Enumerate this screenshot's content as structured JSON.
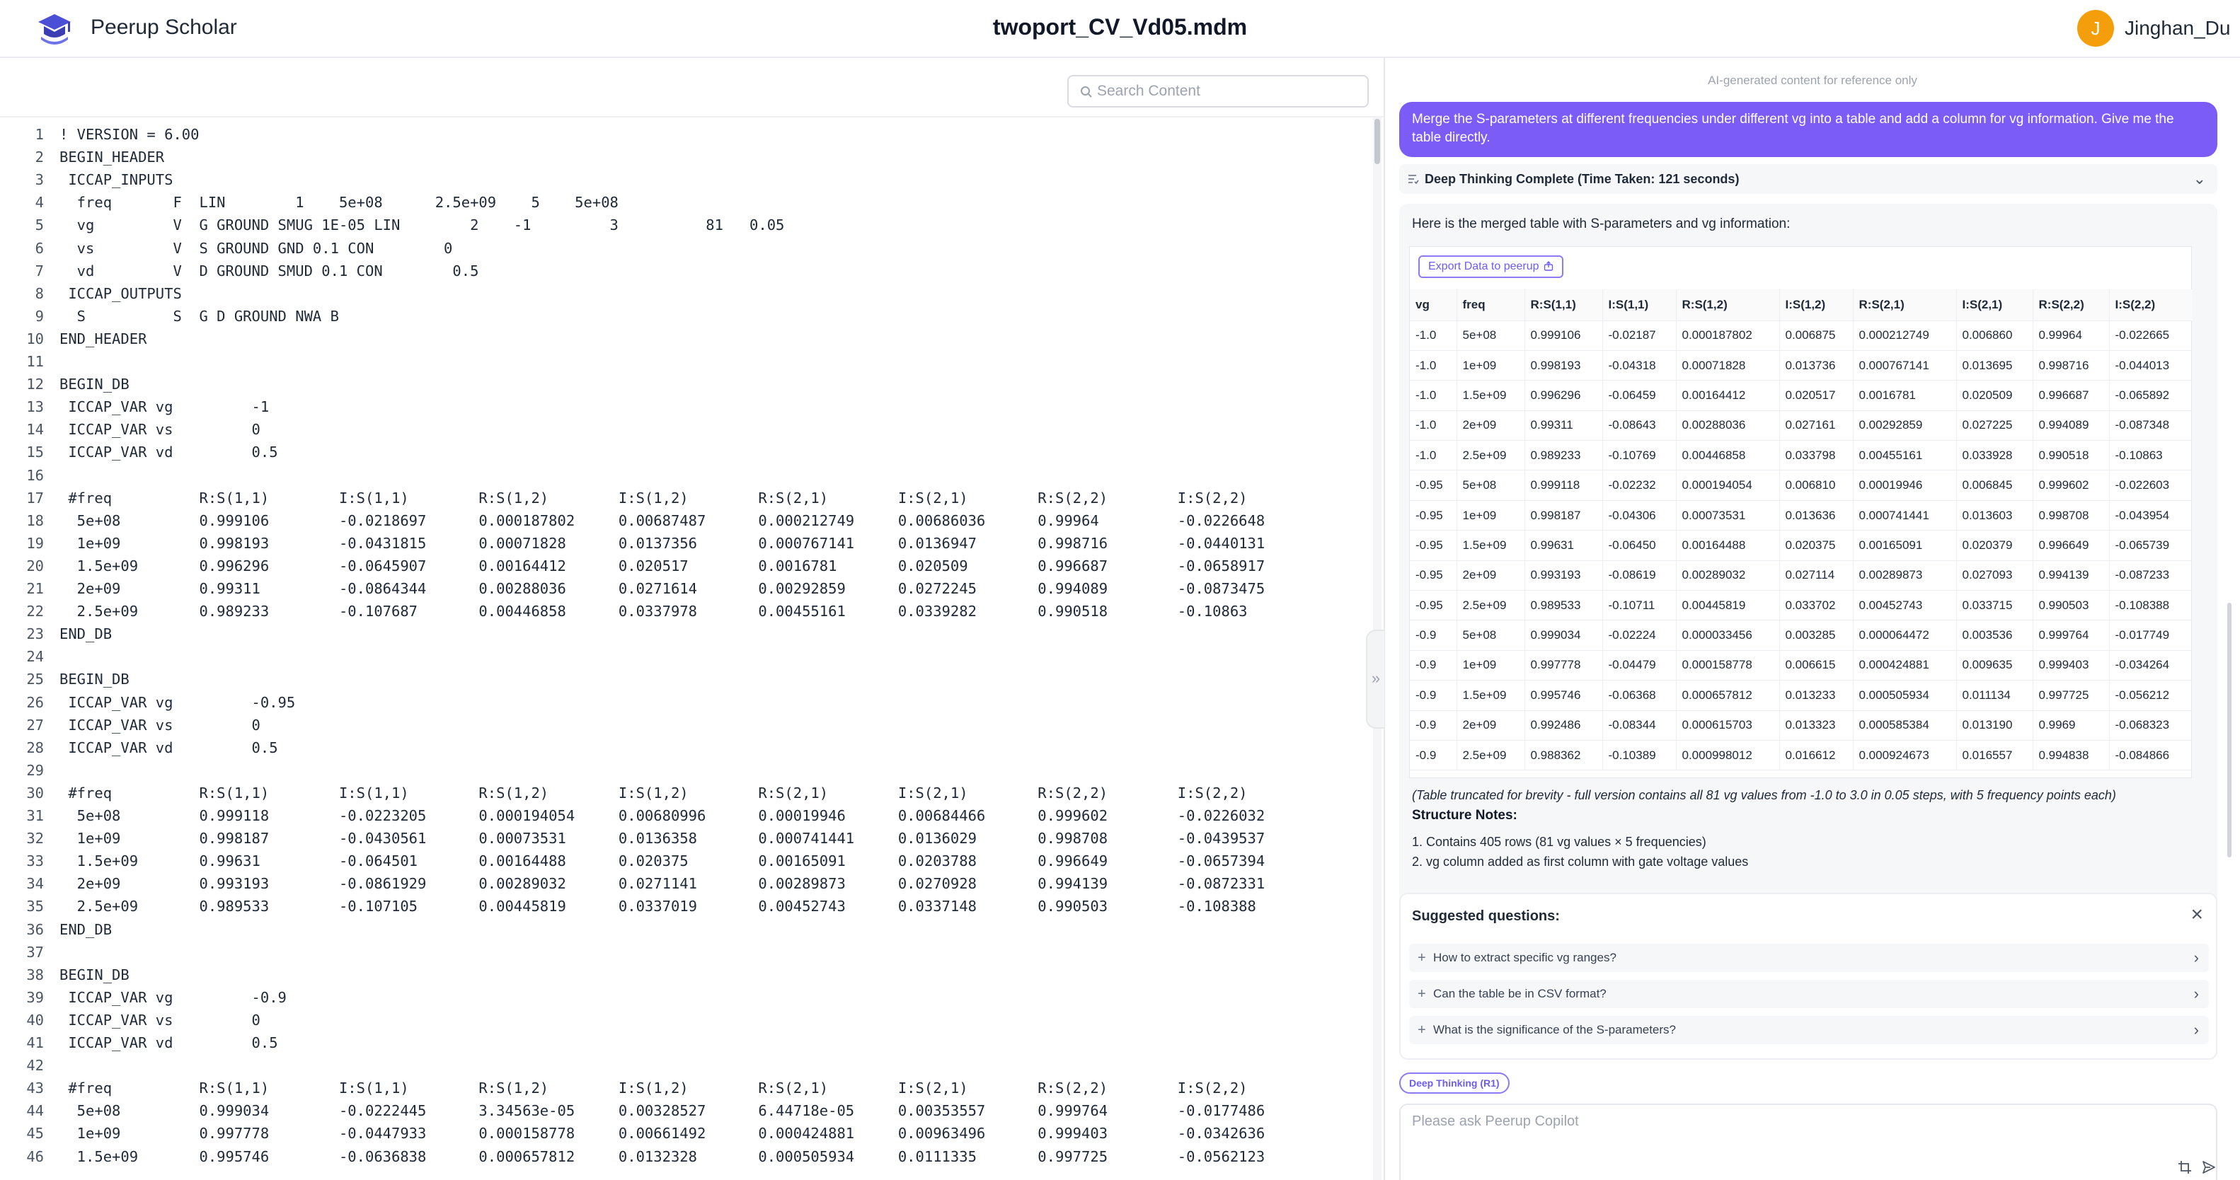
{
  "header": {
    "app_name": "Peerup Scholar",
    "doc_title": "twoport_CV_Vd05.mdm",
    "avatar_letter": "J",
    "username": "Jinghan_Du",
    "avatar_color": "#f59e0b"
  },
  "editor": {
    "search_placeholder": "Search Content",
    "lines": [
      {
        "n": "1",
        "t": "! VERSION = 6.00"
      },
      {
        "n": "2",
        "t": "BEGIN_HEADER"
      },
      {
        "n": "3",
        "t": " ICCAP_INPUTS"
      },
      {
        "n": "4",
        "t": "  freq       F  LIN        1    5e+08      2.5e+09    5    5e+08"
      },
      {
        "n": "5",
        "t": "  vg         V  G GROUND SMUG 1E-05 LIN        2    -1         3          81   0.05"
      },
      {
        "n": "6",
        "t": "  vs         V  S GROUND GND 0.1 CON        0"
      },
      {
        "n": "7",
        "t": "  vd         V  D GROUND SMUD 0.1 CON        0.5"
      },
      {
        "n": "8",
        "t": " ICCAP_OUTPUTS"
      },
      {
        "n": "9",
        "t": "  S          S  G D GROUND NWA B"
      },
      {
        "n": "10",
        "t": "END_HEADER"
      },
      {
        "n": "11",
        "t": ""
      },
      {
        "n": "12",
        "t": "BEGIN_DB"
      },
      {
        "n": "13",
        "t": " ICCAP_VAR vg         -1"
      },
      {
        "n": "14",
        "t": " ICCAP_VAR vs         0"
      },
      {
        "n": "15",
        "t": " ICCAP_VAR vd         0.5"
      },
      {
        "n": "16",
        "t": ""
      },
      {
        "n": "17",
        "t": " #freq          R:S(1,1)        I:S(1,1)        R:S(1,2)        I:S(1,2)        R:S(2,1)        I:S(2,1)        R:S(2,2)        I:S(2,2)"
      },
      {
        "n": "18",
        "t": "  5e+08         0.999106        -0.0218697      0.000187802     0.00687487      0.000212749     0.00686036      0.99964         -0.0226648"
      },
      {
        "n": "19",
        "t": "  1e+09         0.998193        -0.0431815      0.00071828      0.0137356       0.000767141     0.0136947       0.998716        -0.0440131"
      },
      {
        "n": "20",
        "t": "  1.5e+09       0.996296        -0.0645907      0.00164412      0.020517        0.0016781       0.020509        0.996687        -0.0658917"
      },
      {
        "n": "21",
        "t": "  2e+09         0.99311         -0.0864344      0.00288036      0.0271614       0.00292859      0.0272245       0.994089        -0.0873475"
      },
      {
        "n": "22",
        "t": "  2.5e+09       0.989233        -0.107687       0.00446858      0.0337978       0.00455161      0.0339282       0.990518        -0.10863"
      },
      {
        "n": "23",
        "t": "END_DB"
      },
      {
        "n": "24",
        "t": ""
      },
      {
        "n": "25",
        "t": "BEGIN_DB"
      },
      {
        "n": "26",
        "t": " ICCAP_VAR vg         -0.95"
      },
      {
        "n": "27",
        "t": " ICCAP_VAR vs         0"
      },
      {
        "n": "28",
        "t": " ICCAP_VAR vd         0.5"
      },
      {
        "n": "29",
        "t": ""
      },
      {
        "n": "30",
        "t": " #freq          R:S(1,1)        I:S(1,1)        R:S(1,2)        I:S(1,2)        R:S(2,1)        I:S(2,1)        R:S(2,2)        I:S(2,2)"
      },
      {
        "n": "31",
        "t": "  5e+08         0.999118        -0.0223205      0.000194054     0.00680996      0.00019946      0.00684466      0.999602        -0.0226032"
      },
      {
        "n": "32",
        "t": "  1e+09         0.998187        -0.0430561      0.00073531      0.0136358       0.000741441     0.0136029       0.998708        -0.0439537"
      },
      {
        "n": "33",
        "t": "  1.5e+09       0.99631         -0.064501       0.00164488      0.020375        0.00165091      0.0203788       0.996649        -0.0657394"
      },
      {
        "n": "34",
        "t": "  2e+09         0.993193        -0.0861929      0.00289032      0.0271141       0.00289873      0.0270928       0.994139        -0.0872331"
      },
      {
        "n": "35",
        "t": "  2.5e+09       0.989533        -0.107105       0.00445819      0.0337019       0.00452743      0.0337148       0.990503        -0.108388"
      },
      {
        "n": "36",
        "t": "END_DB"
      },
      {
        "n": "37",
        "t": ""
      },
      {
        "n": "38",
        "t": "BEGIN_DB"
      },
      {
        "n": "39",
        "t": " ICCAP_VAR vg         -0.9"
      },
      {
        "n": "40",
        "t": " ICCAP_VAR vs         0"
      },
      {
        "n": "41",
        "t": " ICCAP_VAR vd         0.5"
      },
      {
        "n": "42",
        "t": ""
      },
      {
        "n": "43",
        "t": " #freq          R:S(1,1)        I:S(1,1)        R:S(1,2)        I:S(1,2)        R:S(2,1)        I:S(2,1)        R:S(2,2)        I:S(2,2)"
      },
      {
        "n": "44",
        "t": "  5e+08         0.999034        -0.0222445      3.34563e-05     0.00328527      6.44718e-05     0.00353557      0.999764        -0.0177486"
      },
      {
        "n": "45",
        "t": "  1e+09         0.997778        -0.0447933      0.000158778     0.00661492      0.000424881     0.00963496      0.999403        -0.0342636"
      },
      {
        "n": "46",
        "t": "  1.5e+09       0.995746        -0.0636838      0.000657812     0.0132328       0.000505934     0.0111335       0.997725        -0.0562123"
      }
    ]
  },
  "assistant": {
    "disclaimer": "AI-generated content for reference only",
    "user_message": "Merge the S-parameters at different frequencies under different vg into a table and add a column for vg information. Give me the table directly.",
    "thinking_status": "Deep Thinking Complete (Time Taken: 121 seconds)",
    "answer_intro": "Here is the merged table with S-parameters and vg information:",
    "export_label": "Export Data to peerup",
    "table": {
      "headers": [
        "vg",
        "freq",
        "R:S(1,1)",
        "I:S(1,1)",
        "R:S(1,2)",
        "I:S(1,2)",
        "R:S(2,1)",
        "I:S(2,1)",
        "R:S(2,2)",
        "I:S(2,2)"
      ],
      "rows": [
        [
          "-1.0",
          "5e+08",
          "0.999106",
          "-0.02187",
          "0.000187802",
          "0.006875",
          "0.000212749",
          "0.006860",
          "0.99964",
          "-0.022665"
        ],
        [
          "-1.0",
          "1e+09",
          "0.998193",
          "-0.04318",
          "0.00071828",
          "0.013736",
          "0.000767141",
          "0.013695",
          "0.998716",
          "-0.044013"
        ],
        [
          "-1.0",
          "1.5e+09",
          "0.996296",
          "-0.06459",
          "0.00164412",
          "0.020517",
          "0.0016781",
          "0.020509",
          "0.996687",
          "-0.065892"
        ],
        [
          "-1.0",
          "2e+09",
          "0.99311",
          "-0.08643",
          "0.00288036",
          "0.027161",
          "0.00292859",
          "0.027225",
          "0.994089",
          "-0.087348"
        ],
        [
          "-1.0",
          "2.5e+09",
          "0.989233",
          "-0.10769",
          "0.00446858",
          "0.033798",
          "0.00455161",
          "0.033928",
          "0.990518",
          "-0.10863"
        ],
        [
          "-0.95",
          "5e+08",
          "0.999118",
          "-0.02232",
          "0.000194054",
          "0.006810",
          "0.00019946",
          "0.006845",
          "0.999602",
          "-0.022603"
        ],
        [
          "-0.95",
          "1e+09",
          "0.998187",
          "-0.04306",
          "0.00073531",
          "0.013636",
          "0.000741441",
          "0.013603",
          "0.998708",
          "-0.043954"
        ],
        [
          "-0.95",
          "1.5e+09",
          "0.99631",
          "-0.06450",
          "0.00164488",
          "0.020375",
          "0.00165091",
          "0.020379",
          "0.996649",
          "-0.065739"
        ],
        [
          "-0.95",
          "2e+09",
          "0.993193",
          "-0.08619",
          "0.00289032",
          "0.027114",
          "0.00289873",
          "0.027093",
          "0.994139",
          "-0.087233"
        ],
        [
          "-0.95",
          "2.5e+09",
          "0.989533",
          "-0.10711",
          "0.00445819",
          "0.033702",
          "0.00452743",
          "0.033715",
          "0.990503",
          "-0.108388"
        ],
        [
          "-0.9",
          "5e+08",
          "0.999034",
          "-0.02224",
          "0.000033456",
          "0.003285",
          "0.000064472",
          "0.003536",
          "0.999764",
          "-0.017749"
        ],
        [
          "-0.9",
          "1e+09",
          "0.997778",
          "-0.04479",
          "0.000158778",
          "0.006615",
          "0.000424881",
          "0.009635",
          "0.999403",
          "-0.034264"
        ],
        [
          "-0.9",
          "1.5e+09",
          "0.995746",
          "-0.06368",
          "0.000657812",
          "0.013233",
          "0.000505934",
          "0.011134",
          "0.997725",
          "-0.056212"
        ],
        [
          "-0.9",
          "2e+09",
          "0.992486",
          "-0.08344",
          "0.000615703",
          "0.013323",
          "0.000585384",
          "0.013190",
          "0.9969",
          "-0.068323"
        ],
        [
          "-0.9",
          "2.5e+09",
          "0.988362",
          "-0.10389",
          "0.000998012",
          "0.016612",
          "0.000924673",
          "0.016557",
          "0.994838",
          "-0.084866"
        ]
      ]
    },
    "table_note": "(Table truncated for brevity - full version contains all 81 vg values from -1.0 to 3.0 in 0.05 steps, with 5 frequency points each)",
    "structure_title": "Structure Notes:",
    "structure_notes": [
      "1. Contains 405 rows (81 vg values × 5 frequencies)",
      "2. vg column added as first column with gate voltage values"
    ],
    "suggested_title": "Suggested questions:",
    "suggested_questions": [
      "How to extract specific vg ranges?",
      "Can the table be in CSV format?",
      "What is the significance of the S-parameters?"
    ],
    "mode_tag": "Deep Thinking (R1)",
    "composer_placeholder": "Please ask Peerup Copilot"
  },
  "colors": {
    "accent": "#7c5cf6",
    "avatar": "#f59e0b"
  },
  "icons": [
    "logo-icon",
    "search-icon",
    "checklist-icon",
    "chevron-down-icon",
    "export-icon",
    "close-icon",
    "plus-icon",
    "chevron-right-icon",
    "crop-icon",
    "send-icon",
    "collapse-icon"
  ]
}
